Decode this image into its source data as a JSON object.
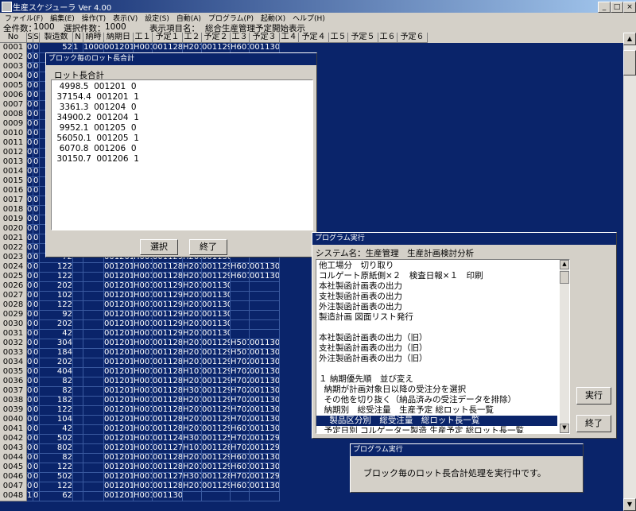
{
  "app": {
    "title": "生産スケジューラ Ver 4.00"
  },
  "menu": [
    "ファイル(F)",
    "編集(E)",
    "操作(T)",
    "表示(V)",
    "設定(S)",
    "自動(A)",
    "プログラム(P)",
    "起動(X)",
    "ヘルプ(H)"
  ],
  "info": {
    "total_label": "全件数：",
    "total": "1000",
    "selected_label": "選択件数：",
    "selected": "1000",
    "item_label": "表示項目名：",
    "item": "総合生産管理予定開始表示"
  },
  "grid": {
    "headers": [
      "No",
      "S",
      "S",
      "製造数",
      "N",
      "納時",
      "納期日",
      "工１",
      "予定１",
      "工２",
      "予定２",
      "工３",
      "予定３",
      "工４",
      "予定４",
      "工５",
      "予定５",
      "工６",
      "予定６"
    ],
    "rows": [
      [
        "0001",
        "0",
        "0",
        "52",
        "1",
        "1000",
        "001201",
        "H001",
        "001128",
        "H201",
        "001129",
        "H601",
        "001130"
      ],
      [
        "0002",
        "0",
        "0",
        "",
        "",
        "",
        "",
        "",
        "",
        "",
        "",
        "",
        ""
      ],
      [
        "0003",
        "0",
        "0",
        "",
        "",
        "",
        "",
        "",
        "",
        "",
        "",
        "",
        ""
      ],
      [
        "0004",
        "0",
        "0",
        "",
        "",
        "",
        "",
        "",
        "",
        "",
        "",
        "",
        ""
      ],
      [
        "0005",
        "0",
        "0",
        "",
        "",
        "",
        "",
        "",
        "",
        "",
        "",
        "",
        ""
      ],
      [
        "0006",
        "0",
        "0",
        "",
        "",
        "",
        "",
        "",
        "",
        "",
        "",
        "",
        ""
      ],
      [
        "0007",
        "0",
        "0",
        "",
        "",
        "",
        "",
        "",
        "",
        "",
        "",
        "",
        ""
      ],
      [
        "0008",
        "0",
        "0",
        "",
        "",
        "",
        "",
        "",
        "",
        "",
        "",
        "",
        ""
      ],
      [
        "0009",
        "0",
        "0",
        "",
        "",
        "",
        "",
        "",
        "",
        "",
        "",
        "",
        ""
      ],
      [
        "0010",
        "0",
        "0",
        "",
        "",
        "",
        "",
        "",
        "",
        "",
        "",
        "",
        ""
      ],
      [
        "0011",
        "0",
        "0",
        "",
        "",
        "",
        "",
        "",
        "",
        "",
        "",
        "",
        ""
      ],
      [
        "0012",
        "0",
        "0",
        "",
        "",
        "",
        "",
        "",
        "",
        "",
        "",
        "",
        ""
      ],
      [
        "0013",
        "0",
        "0",
        "",
        "",
        "",
        "",
        "",
        "",
        "",
        "",
        "",
        ""
      ],
      [
        "0014",
        "0",
        "0",
        "",
        "",
        "",
        "",
        "",
        "",
        "",
        "",
        "",
        "001130"
      ],
      [
        "0015",
        "0",
        "0",
        "",
        "",
        "",
        "",
        "",
        "",
        "",
        "",
        "",
        ""
      ],
      [
        "0016",
        "0",
        "0",
        "",
        "",
        "",
        "",
        "",
        "",
        "",
        "",
        "",
        ""
      ],
      [
        "0017",
        "0",
        "0",
        "",
        "",
        "",
        "",
        "",
        "",
        "",
        "",
        "",
        ""
      ],
      [
        "0018",
        "0",
        "0",
        "",
        "",
        "",
        "",
        "",
        "",
        "",
        "",
        "",
        ""
      ],
      [
        "0019",
        "0",
        "0",
        "",
        "",
        "",
        "",
        "",
        "",
        "",
        "",
        "",
        ""
      ],
      [
        "0020",
        "0",
        "0",
        "",
        "",
        "",
        "",
        "",
        "",
        "",
        "",
        "",
        ""
      ],
      [
        "0021",
        "0",
        "0",
        "",
        "",
        "",
        "",
        "",
        "",
        "",
        "",
        "",
        ""
      ],
      [
        "0022",
        "0",
        "0",
        "",
        "",
        "",
        "",
        "",
        "",
        "",
        "",
        "",
        ""
      ],
      [
        "0023",
        "0",
        "0",
        "72",
        "",
        "",
        "001201",
        "H001",
        "001129",
        "H201",
        "001130",
        "",
        ""
      ],
      [
        "0024",
        "0",
        "0",
        "122",
        "",
        "",
        "001201",
        "H001",
        "001128",
        "H201",
        "001129",
        "H601",
        "001130"
      ],
      [
        "0025",
        "0",
        "0",
        "122",
        "",
        "",
        "001201",
        "H001",
        "001128",
        "H201",
        "001129",
        "H601",
        "001130"
      ],
      [
        "0026",
        "0",
        "0",
        "202",
        "",
        "",
        "001201",
        "H001",
        "001129",
        "H201",
        "001130",
        "",
        ""
      ],
      [
        "0027",
        "0",
        "0",
        "102",
        "",
        "",
        "001201",
        "H001",
        "001129",
        "H201",
        "001130",
        "",
        ""
      ],
      [
        "0028",
        "0",
        "0",
        "122",
        "",
        "",
        "001201",
        "H001",
        "001129",
        "H201",
        "001130",
        "",
        ""
      ],
      [
        "0029",
        "0",
        "0",
        "92",
        "",
        "",
        "001201",
        "H001",
        "001129",
        "H201",
        "001130",
        "",
        ""
      ],
      [
        "0030",
        "0",
        "0",
        "202",
        "",
        "",
        "001201",
        "H001",
        "001129",
        "H201",
        "001130",
        "",
        ""
      ],
      [
        "0031",
        "0",
        "0",
        "42",
        "",
        "",
        "001201",
        "H001",
        "001129",
        "H201",
        "001130",
        "",
        ""
      ],
      [
        "0032",
        "0",
        "0",
        "304",
        "",
        "",
        "001201",
        "H001",
        "001128",
        "H201",
        "001129",
        "H501",
        "001130"
      ],
      [
        "0033",
        "0",
        "0",
        "184",
        "",
        "",
        "001201",
        "H001",
        "001128",
        "H201",
        "001129",
        "H501",
        "001130"
      ],
      [
        "0034",
        "0",
        "0",
        "202",
        "",
        "",
        "001201",
        "H001",
        "001128",
        "H201",
        "001129",
        "H702",
        "001130"
      ],
      [
        "0035",
        "0",
        "0",
        "404",
        "",
        "",
        "001201",
        "H001",
        "001128",
        "H101",
        "001129",
        "H702",
        "001130"
      ],
      [
        "0036",
        "0",
        "0",
        "82",
        "",
        "",
        "001201",
        "H001",
        "001128",
        "H201",
        "001129",
        "H702",
        "001130"
      ],
      [
        "0037",
        "0",
        "0",
        "82",
        "",
        "",
        "001201",
        "H001",
        "001128",
        "H301",
        "001129",
        "H702",
        "001130"
      ],
      [
        "0038",
        "0",
        "0",
        "182",
        "",
        "",
        "001201",
        "H001",
        "001128",
        "H201",
        "001129",
        "H702",
        "001130"
      ],
      [
        "0039",
        "0",
        "0",
        "122",
        "",
        "",
        "001201",
        "H001",
        "001128",
        "H201",
        "001129",
        "H702",
        "001130"
      ],
      [
        "0040",
        "0",
        "0",
        "104",
        "",
        "",
        "001201",
        "H001",
        "001128",
        "H201",
        "001129",
        "H702",
        "001130"
      ],
      [
        "0041",
        "0",
        "0",
        "42",
        "",
        "",
        "001201",
        "H001",
        "001128",
        "H201",
        "001129",
        "H601",
        "001130"
      ],
      [
        "0042",
        "0",
        "0",
        "502",
        "",
        "",
        "001201",
        "H001",
        "001124",
        "H301",
        "001125",
        "H702",
        "001129"
      ],
      [
        "0043",
        "0",
        "0",
        "802",
        "",
        "",
        "001201",
        "H001",
        "001127",
        "H101",
        "001128",
        "H702",
        "001129"
      ],
      [
        "0044",
        "0",
        "0",
        "82",
        "",
        "",
        "001201",
        "H001",
        "001128",
        "H201",
        "001129",
        "H601",
        "001130"
      ],
      [
        "0045",
        "0",
        "0",
        "122",
        "",
        "",
        "001201",
        "H001",
        "001128",
        "H201",
        "001129",
        "H601",
        "001130"
      ],
      [
        "0046",
        "0",
        "0",
        "502",
        "",
        "",
        "001201",
        "H001",
        "001127",
        "H301",
        "001128",
        "H702",
        "001129"
      ],
      [
        "0047",
        "0",
        "0",
        "122",
        "",
        "",
        "001201",
        "H001",
        "001128",
        "H201",
        "001129",
        "H601",
        "001130"
      ],
      [
        "0048",
        "1",
        "0",
        "62",
        "",
        "",
        "001201",
        "H001",
        "001130",
        "",
        "",
        "",
        ""
      ]
    ]
  },
  "lot_dialog": {
    "title": "ブロック毎のロット長合計",
    "header": "ロット長合計",
    "lines": [
      "  4998.5  001201  0",
      " 37154.4  001201  1",
      "  3361.3  001204  0",
      " 34900.2  001204  1",
      "  9952.1  001205  0",
      " 56050.1  001205  1",
      "  6070.8  001206  0",
      " 30150.7  001206  1"
    ],
    "select_label": "選択",
    "close_label": "終了"
  },
  "prog_dialog": {
    "title": "プログラム実行",
    "system_label": "システム名：",
    "system_name": "生産管理　生産計画検討分析",
    "items": [
      "他工場分　切り取り",
      "コルゲート原紙側×２　検査日報×１　印刷",
      "本社製函計画表の出力",
      "支社製函計画表の出力",
      "外注製函計画表の出力",
      "製造計画 図面リスト発行",
      "",
      "本社製函計画表の出力（旧）",
      "支社製函計画表の出力（旧）",
      "外注製函計画表の出力（旧）",
      "",
      "１ 納期優先順　並び変え",
      "  納期が計画対象日以降の受注分を選択",
      "  その他を切り抜く（納品済みの受注データを排除）",
      "  納期別　総受注量　生産予定 総ロット長一覧",
      "    製品区分別　総受注量　総ロット長一覧",
      "  予定日別 コルゲーター製造 生産予定 総ロット長一覧",
      "      シート生産 生産予定 総ロット長一覧"
    ],
    "selected_index": 15,
    "run_label": "実行",
    "close_label": "終了"
  },
  "status_dialog": {
    "title": "プログラム実行",
    "message": "ブロック毎のロット長合計処理を実行中です。"
  }
}
